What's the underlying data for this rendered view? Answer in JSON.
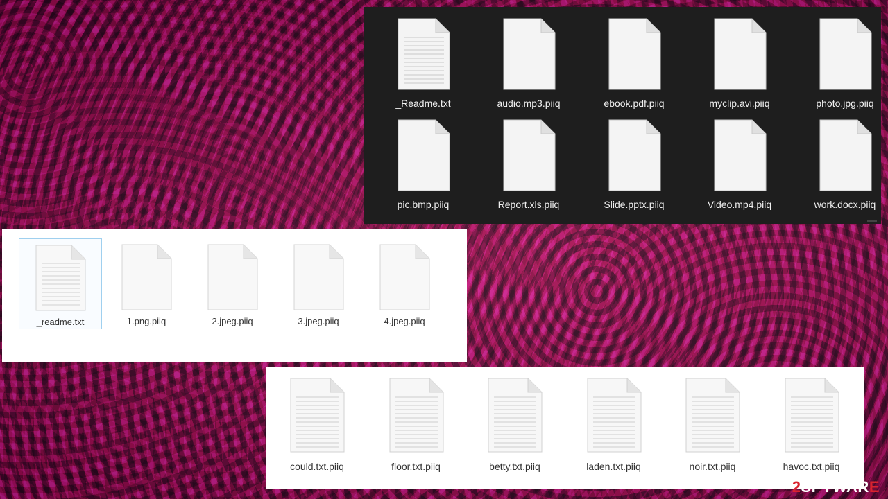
{
  "dark_window": {
    "files": [
      {
        "name": "_Readme.txt",
        "icon": "text-document-icon"
      },
      {
        "name": "audio.mp3.piiq",
        "icon": "blank-document-icon"
      },
      {
        "name": "ebook.pdf.piiq",
        "icon": "blank-document-icon"
      },
      {
        "name": "myclip.avi.piiq",
        "icon": "blank-document-icon"
      },
      {
        "name": "photo.jpg.piiq",
        "icon": "blank-document-icon"
      },
      {
        "name": "pic.bmp.piiq",
        "icon": "blank-document-icon"
      },
      {
        "name": "Report.xls.piiq",
        "icon": "blank-document-icon"
      },
      {
        "name": "Slide.pptx.piiq",
        "icon": "blank-document-icon"
      },
      {
        "name": "Video.mp4.piiq",
        "icon": "blank-document-icon"
      },
      {
        "name": "work.docx.piiq",
        "icon": "blank-document-icon"
      }
    ]
  },
  "middle_window": {
    "files": [
      {
        "name": "_readme.txt",
        "icon": "text-document-icon",
        "selected": true
      },
      {
        "name": "1.png.piiq",
        "icon": "blank-document-icon"
      },
      {
        "name": "2.jpeg.piiq",
        "icon": "blank-document-icon"
      },
      {
        "name": "3.jpeg.piiq",
        "icon": "blank-document-icon"
      },
      {
        "name": "4.jpeg.piiq",
        "icon": "blank-document-icon"
      }
    ]
  },
  "bottom_window": {
    "files": [
      {
        "name": "could.txt.piiq",
        "icon": "text-document-icon"
      },
      {
        "name": "floor.txt.piiq",
        "icon": "text-document-icon"
      },
      {
        "name": "betty.txt.piiq",
        "icon": "text-document-icon"
      },
      {
        "name": "laden.txt.piiq",
        "icon": "text-document-icon"
      },
      {
        "name": "noir.txt.piiq",
        "icon": "text-document-icon"
      },
      {
        "name": "havoc.txt.piiq",
        "icon": "text-document-icon"
      }
    ]
  },
  "watermark": {
    "prefix": "2",
    "middle": "SPYWAR",
    "suffix": "E"
  },
  "colors": {
    "dark_panel": "#1e1e1e",
    "light_panel": "#ffffff",
    "selection_border": "#9fd0ef",
    "brand_red": "#d9232f"
  }
}
